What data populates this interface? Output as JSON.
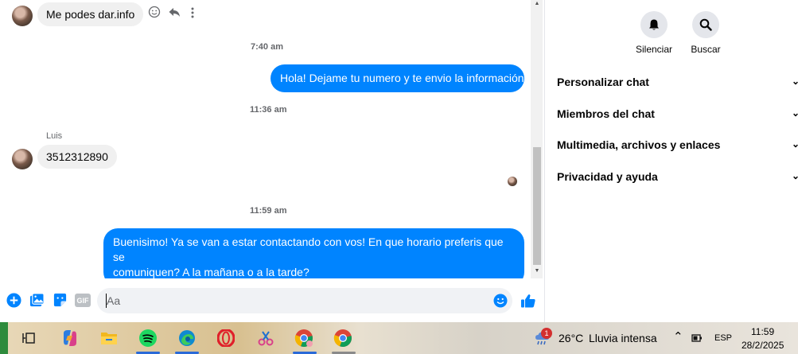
{
  "chat": {
    "messages": [
      {
        "text": "Me podes dar.info"
      },
      {
        "time": "7:40 am"
      },
      {
        "text": "Hola! Dejame tu numero y te envio la información"
      },
      {
        "time": "11:36 am"
      },
      {
        "sender": "Luis"
      },
      {
        "text": "3512312890"
      },
      {
        "time": "11:59 am"
      },
      {
        "text_line1": "Buenisimo! Ya se van a estar contactando con vos! En que horario preferis que se",
        "text_line2": "comuniquen? A la mañana o a la tarde?"
      }
    ],
    "composer_placeholder": "Aa",
    "gif_label": "GIF"
  },
  "sidebar": {
    "mute_label": "Silenciar",
    "search_label": "Buscar",
    "items": [
      {
        "label": "Personalizar chat"
      },
      {
        "label": "Miembros del chat"
      },
      {
        "label": "Multimedia, archivos y enlaces"
      },
      {
        "label": "Privacidad y ayuda"
      }
    ]
  },
  "taskbar": {
    "weather_temp": "26°C",
    "weather_desc": "Lluvia intensa",
    "weather_badge": "1",
    "language": "ESP",
    "time": "11:59",
    "date": "28/2/2025"
  },
  "colors": {
    "accent": "#0084ff",
    "bubble_in": "#f0f0f0"
  },
  "icons": [
    "smile-icon",
    "reply-icon",
    "more-icon",
    "plus-icon",
    "image-icon",
    "sticker-icon",
    "gif-icon",
    "emoji-icon",
    "like-icon",
    "bell-icon",
    "search-icon",
    "chevron-down-icon",
    "task-view-icon",
    "copilot-icon",
    "file-explorer-icon",
    "spotify-icon",
    "edge-icon",
    "opera-icon",
    "snipping-icon",
    "chrome-icon"
  ]
}
